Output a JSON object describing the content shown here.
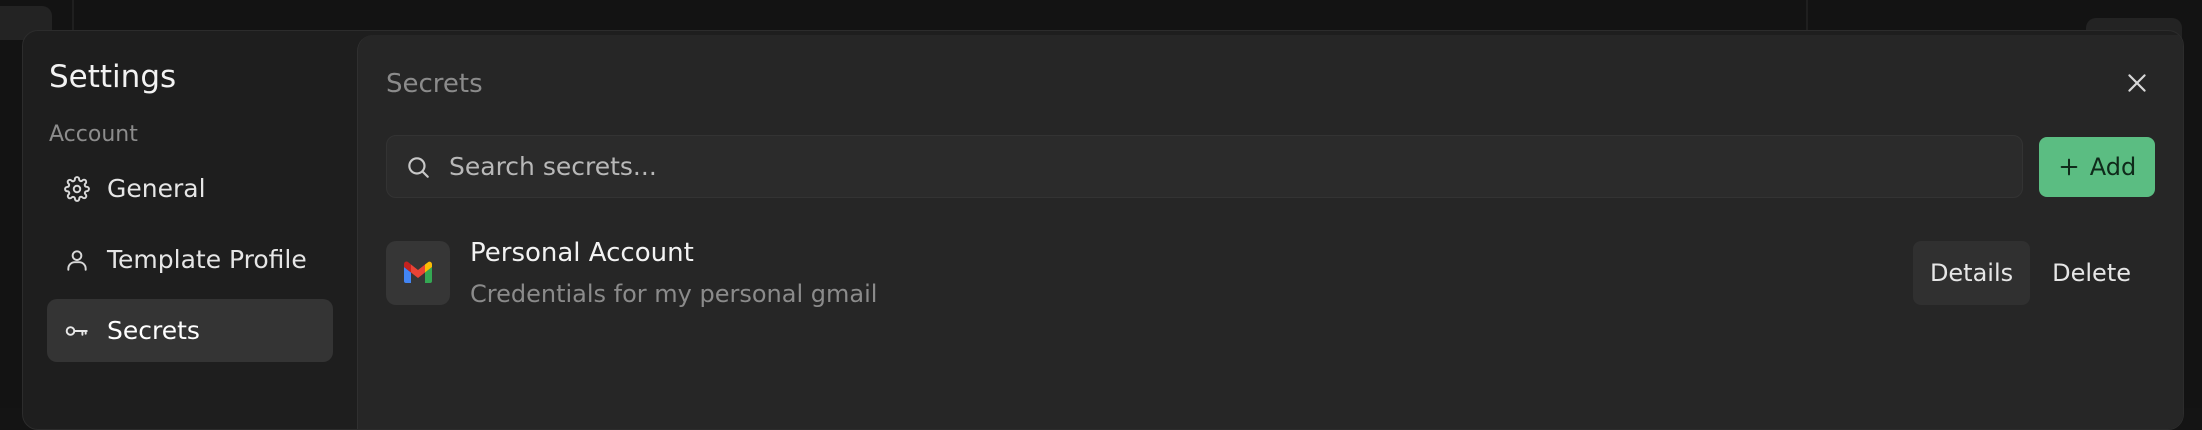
{
  "sidebar": {
    "title": "Settings",
    "section": "Account",
    "items": [
      {
        "label": "General",
        "icon": "gear-icon",
        "active": false
      },
      {
        "label": "Template Profile",
        "icon": "user-icon",
        "active": false
      },
      {
        "label": "Secrets",
        "icon": "key-icon",
        "active": true
      }
    ]
  },
  "content": {
    "title": "Secrets",
    "search": {
      "placeholder": "Search secrets...",
      "value": ""
    },
    "add_label": "Add",
    "secrets": [
      {
        "name": "Personal Account",
        "description": "Credentials for my personal gmail",
        "icon": "gmail-icon",
        "details_label": "Details",
        "delete_label": "Delete"
      }
    ]
  },
  "colors": {
    "accent": "#5bbd82",
    "modal_bg": "#1e1e1e",
    "content_bg": "#262626",
    "active_item": "#343434"
  }
}
